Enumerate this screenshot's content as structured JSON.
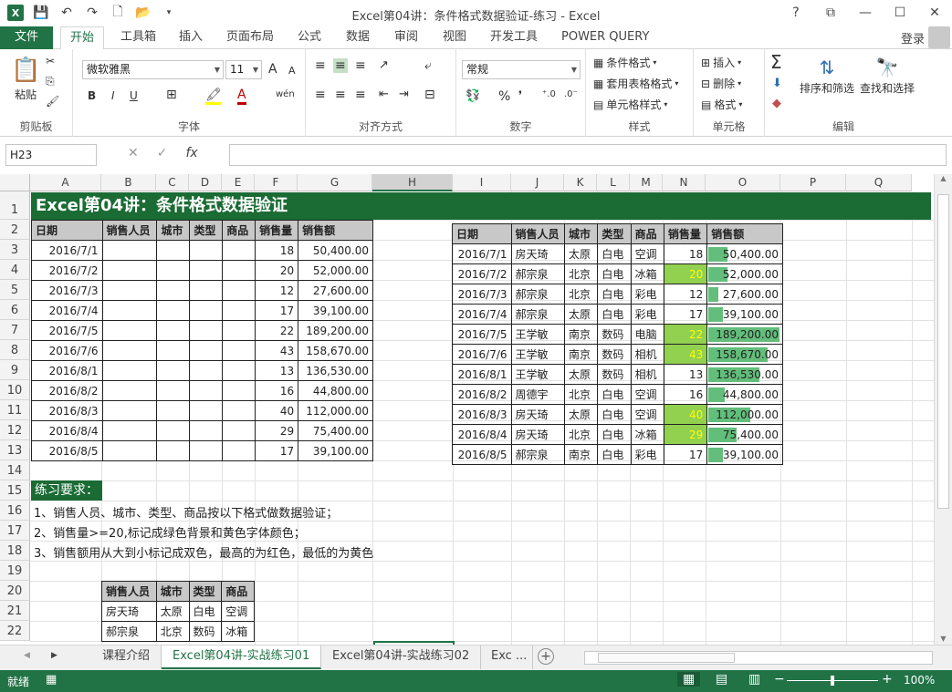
{
  "window": {
    "title": "Excel第04讲：条件格式数据验证-练习 - Excel",
    "controls": [
      "?",
      "⧉",
      "—",
      "☐",
      "✕"
    ]
  },
  "tabs": [
    "文件",
    "开始",
    "工具箱",
    "插入",
    "页面布局",
    "公式",
    "数据",
    "审阅",
    "视图",
    "开发工具",
    "POWER QUERY"
  ],
  "login": "登录",
  "ribbon": {
    "clipboard": {
      "label": "剪贴板",
      "paste": "粘贴"
    },
    "font": {
      "label": "字体",
      "name": "微软雅黑",
      "size": "11",
      "bold": "B",
      "italic": "I",
      "underline": "U",
      "grow": "A",
      "shrink": "A",
      "wen": "wén"
    },
    "align": {
      "label": "对齐方式"
    },
    "number": {
      "label": "数字",
      "format": "常规",
      "percent": "%"
    },
    "styles": {
      "label": "样式",
      "cond": "条件格式",
      "table": "套用表格格式",
      "cell": "单元格样式"
    },
    "cells": {
      "label": "单元格",
      "insert": "插入",
      "delete": "删除",
      "format": "格式"
    },
    "edit": {
      "label": "编辑",
      "sort": "排序和筛选",
      "find": "查找和选择",
      "sum": "Σ"
    }
  },
  "formula": {
    "namebox": "H23",
    "fx": "fx",
    "cancel": "✕",
    "enter": "✓",
    "value": ""
  },
  "columns": [
    "A",
    "B",
    "C",
    "D",
    "E",
    "F",
    "G",
    "H",
    "I",
    "J",
    "K",
    "L",
    "M",
    "N",
    "O",
    "P",
    "Q"
  ],
  "rows": [
    "1",
    "2",
    "3",
    "4",
    "5",
    "6",
    "7",
    "8",
    "9",
    "10",
    "11",
    "12",
    "13",
    "14",
    "15",
    "16",
    "17",
    "18",
    "19",
    "20",
    "21",
    "22"
  ],
  "sheet": {
    "title": "Excel第04讲：条件格式数据验证",
    "headers": [
      "日期",
      "销售人员",
      "城市",
      "类型",
      "商品",
      "销售量",
      "销售额"
    ],
    "left": [
      [
        "2016/7/1",
        "",
        "",
        "",
        "",
        "18",
        "50,400.00"
      ],
      [
        "2016/7/2",
        "",
        "",
        "",
        "",
        "20",
        "52,000.00"
      ],
      [
        "2016/7/3",
        "",
        "",
        "",
        "",
        "12",
        "27,600.00"
      ],
      [
        "2016/7/4",
        "",
        "",
        "",
        "",
        "17",
        "39,100.00"
      ],
      [
        "2016/7/5",
        "",
        "",
        "",
        "",
        "22",
        "189,200.00"
      ],
      [
        "2016/7/6",
        "",
        "",
        "",
        "",
        "43",
        "158,670.00"
      ],
      [
        "2016/8/1",
        "",
        "",
        "",
        "",
        "13",
        "136,530.00"
      ],
      [
        "2016/8/2",
        "",
        "",
        "",
        "",
        "16",
        "44,800.00"
      ],
      [
        "2016/8/3",
        "",
        "",
        "",
        "",
        "40",
        "112,000.00"
      ],
      [
        "2016/8/4",
        "",
        "",
        "",
        "",
        "29",
        "75,400.00"
      ],
      [
        "2016/8/5",
        "",
        "",
        "",
        "",
        "17",
        "39,100.00"
      ]
    ],
    "right": [
      [
        "2016/7/1",
        "房天琦",
        "太原",
        "白电",
        "空调",
        "18",
        "50,400.00"
      ],
      [
        "2016/7/2",
        "郝宗泉",
        "北京",
        "白电",
        "冰箱",
        "20",
        "52,000.00"
      ],
      [
        "2016/7/3",
        "郝宗泉",
        "北京",
        "白电",
        "彩电",
        "12",
        "27,600.00"
      ],
      [
        "2016/7/4",
        "郝宗泉",
        "太原",
        "白电",
        "彩电",
        "17",
        "39,100.00"
      ],
      [
        "2016/7/5",
        "王学敏",
        "南京",
        "数码",
        "电脑",
        "22",
        "189,200.00"
      ],
      [
        "2016/7/6",
        "王学敏",
        "南京",
        "数码",
        "相机",
        "43",
        "158,670.00"
      ],
      [
        "2016/8/1",
        "王学敏",
        "太原",
        "数码",
        "相机",
        "13",
        "136,530.00"
      ],
      [
        "2016/8/2",
        "周德宇",
        "北京",
        "白电",
        "空调",
        "16",
        "44,800.00"
      ],
      [
        "2016/8/3",
        "房天琦",
        "太原",
        "白电",
        "空调",
        "40",
        "112,000.00"
      ],
      [
        "2016/8/4",
        "房天琦",
        "北京",
        "白电",
        "冰箱",
        "29",
        "75,400.00"
      ],
      [
        "2016/8/5",
        "郝宗泉",
        "南京",
        "白电",
        "彩电",
        "17",
        "39,100.00"
      ]
    ],
    "highlight_color": "#92d050",
    "highlight_text": "#ffff00",
    "databar_color": "#63be7b",
    "req_title": "练习要求：",
    "req": [
      "1、销售人员、城市、类型、商品按以下格式做数据验证；",
      "2、销售量>=20,标记成绿色背景和黄色字体颜色；",
      "3、销售额用从大到小标记成双色，最高的为红色，最低的为黄色"
    ],
    "small_headers": [
      "销售人员",
      "城市",
      "类型",
      "商品"
    ],
    "small_rows": [
      [
        "房天琦",
        "太原",
        "白电",
        "空调"
      ],
      [
        "郝宗泉",
        "北京",
        "数码",
        "冰箱"
      ]
    ]
  },
  "sheet_tabs": [
    "课程介绍",
    "Excel第04讲-实战练习01",
    "Excel第04讲-实战练习02",
    "Exc ..."
  ],
  "status": {
    "mode": "就绪",
    "zoom": "100%"
  }
}
